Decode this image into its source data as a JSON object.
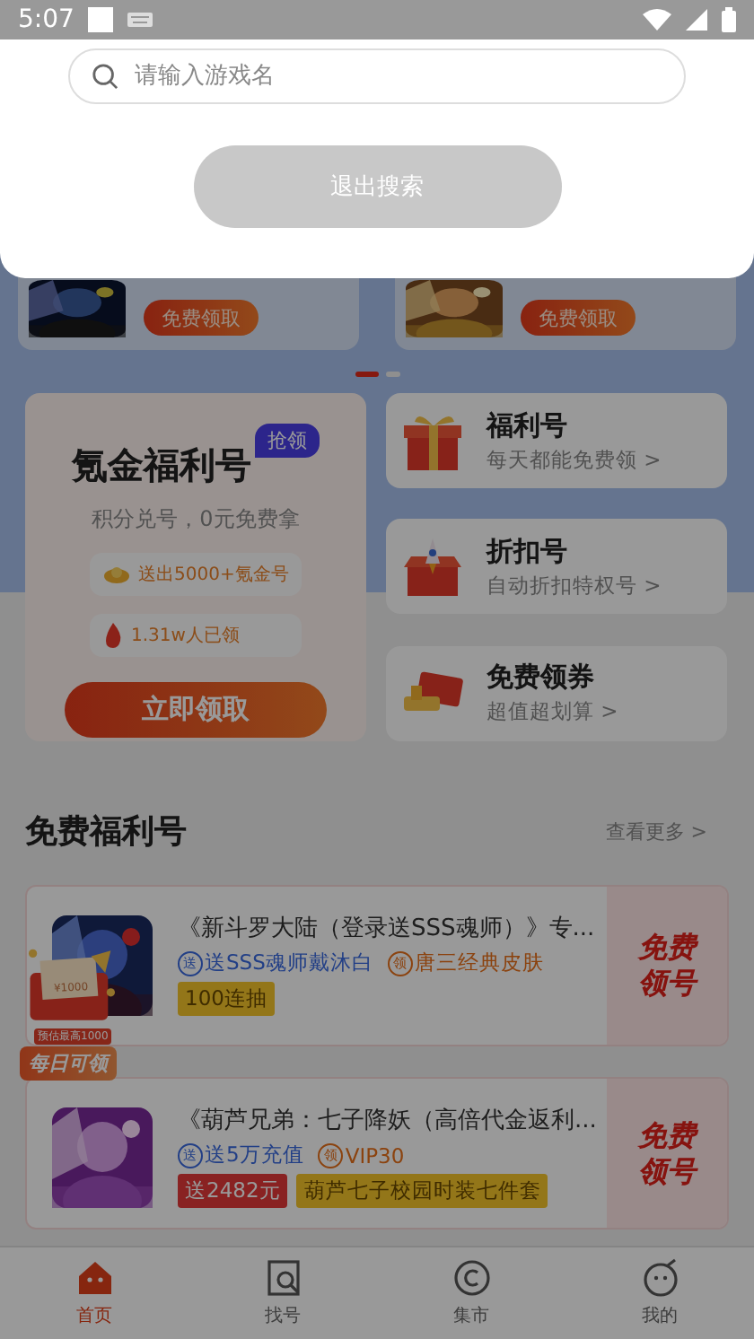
{
  "status_bar": {
    "time": "5:07"
  },
  "search": {
    "placeholder": "请输入游戏名",
    "button": "退出搜索"
  },
  "banners": [
    {
      "button": "免费领取"
    },
    {
      "button": "免费领取"
    }
  ],
  "pager": [
    {
      "selected": true
    },
    {
      "selected": false
    }
  ],
  "featured": {
    "title": "氪金福利号",
    "badge": "抢领",
    "subtitle": "积分兑号，0元免费拿",
    "stats": [
      {
        "kind": "gold",
        "text": "送出5000+氪金号"
      },
      {
        "kind": "fire",
        "text": "1.31w人已领"
      }
    ],
    "button": "立即领取"
  },
  "shortcuts": [
    {
      "kind": "gift",
      "title": "福利号",
      "subtitle": "每天都能免费领 >"
    },
    {
      "kind": "rocket",
      "title": "折扣号",
      "subtitle": "自动折扣特权号 >"
    },
    {
      "kind": "coupon",
      "title": "免费领券",
      "subtitle": "超值超划算 >"
    }
  ],
  "section": {
    "title": "免费福利号",
    "more": "查看更多 >"
  },
  "games": [
    {
      "title": "《新斗罗大陆（登录送SSS魂师）》专...",
      "perks": [
        {
          "kind": "send",
          "icon": "送",
          "text": "送SSS魂师戴沐白"
        },
        {
          "kind": "get",
          "icon": "领",
          "text": "唐三经典皮肤"
        }
      ],
      "tags": [
        {
          "kind": "gold",
          "text": "100连抽"
        }
      ],
      "action": [
        "免费",
        "领号"
      ]
    },
    {
      "title": "《葫芦兄弟：七子降妖（高倍代金返利...",
      "perks": [
        {
          "kind": "send",
          "icon": "送",
          "text": "送5万充值"
        },
        {
          "kind": "get",
          "icon": "领",
          "text": "VIP30"
        }
      ],
      "tags": [
        {
          "kind": "red",
          "text": "送2482元"
        },
        {
          "kind": "gold",
          "text": "葫芦七子校园时装七件套"
        }
      ],
      "action": [
        "免费",
        "领号"
      ]
    }
  ],
  "sticker": {
    "ticket": "¥1000",
    "caption": "预估最高1000",
    "label": "每日可领"
  },
  "tabs": [
    {
      "kind": "home",
      "label": "首页",
      "selected": true
    },
    {
      "kind": "find",
      "label": "找号",
      "selected": false
    },
    {
      "kind": "market",
      "label": "集市",
      "selected": false
    },
    {
      "kind": "me",
      "label": "我的",
      "selected": false
    }
  ]
}
